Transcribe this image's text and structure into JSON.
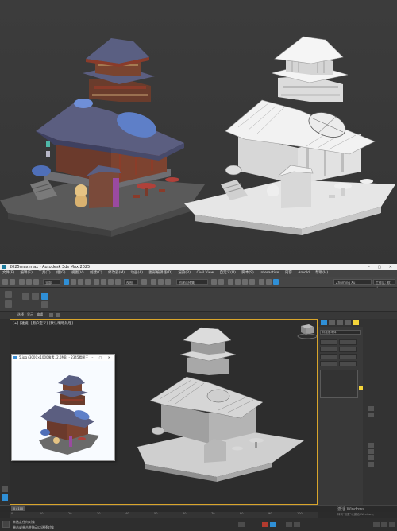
{
  "max": {
    "title": "2025max.max - Autodesk 3ds Max 2025",
    "menu": [
      "文件(F)",
      "编辑(E)",
      "工具(T)",
      "组(G)",
      "视图(V)",
      "创建(C)",
      "修改器(M)",
      "动画(A)",
      "图形编辑器(D)",
      "渲染(R)",
      "Civil View",
      "自定义(U)",
      "脚本(S)",
      "Interactive",
      "内容",
      "Arnold",
      "帮助(H)"
    ],
    "selection_set": "创建选择集",
    "workspace": "工作区: 默认",
    "user": "Zhuming Xu",
    "ribbon_tabs": [
      "选择",
      "显示",
      "编辑"
    ],
    "viewport_label": "[+] [透视] [用户定义] [默认明暗处理]",
    "command_panel_dropdown": "标准基本体"
  },
  "image_viewer": {
    "title": "5.jpg (3000×1000像素, 2.0MB) - 2345看图王"
  },
  "timeline": {
    "ticks": [
      "0",
      "5",
      "10",
      "15",
      "20",
      "25",
      "30",
      "35",
      "40",
      "45",
      "50",
      "55",
      "60",
      "65",
      "70",
      "75",
      "80",
      "85",
      "90",
      "95",
      "100"
    ]
  },
  "status": {
    "line1": "未选定任何对象",
    "line2": "单击或单击并拖动以选择对象"
  },
  "watermark": {
    "line1": "激活 Windows",
    "line2": "转到\"设置\"以激活 Windows。"
  },
  "colors": {
    "accent_blue": "#2f8fd6",
    "viewport_border": "#d9a52b",
    "roof_purple": "#5a5f82",
    "timber_red": "#8a3b2a",
    "umbrella_blue": "#5e7fc8"
  }
}
